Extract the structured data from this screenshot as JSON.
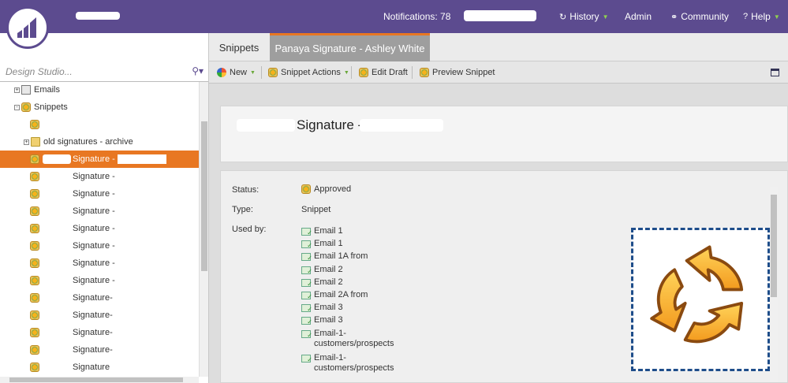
{
  "header": {
    "notifications_label": "Notifications: 78",
    "history_label": "History",
    "admin_label": "Admin",
    "community_label": "Community",
    "help_label": "Help"
  },
  "sidebar": {
    "search_placeholder": "Design Studio...",
    "tree": [
      {
        "label": "Emails",
        "indent": 1,
        "icon": "mail",
        "expander": "+",
        "selected": false
      },
      {
        "label": "Snippets",
        "indent": 1,
        "icon": "snippet",
        "expander": "-",
        "selected": false
      },
      {
        "label": "",
        "indent": 2,
        "icon": "snippet",
        "expander": "",
        "selected": false
      },
      {
        "label": "old signatures - archive",
        "indent": 2,
        "icon": "folder",
        "expander": "+",
        "selected": false
      },
      {
        "label": "Signature -",
        "indent": 2,
        "icon": "snippet",
        "expander": "",
        "selected": true
      },
      {
        "label": "Signature -",
        "indent": 2,
        "icon": "snippet",
        "expander": "",
        "selected": false
      },
      {
        "label": "Signature -",
        "indent": 2,
        "icon": "snippet",
        "expander": "",
        "selected": false
      },
      {
        "label": "Signature -",
        "indent": 2,
        "icon": "snippet",
        "expander": "",
        "selected": false
      },
      {
        "label": "Signature -",
        "indent": 2,
        "icon": "snippet",
        "expander": "",
        "selected": false
      },
      {
        "label": "Signature -",
        "indent": 2,
        "icon": "snippet",
        "expander": "",
        "selected": false
      },
      {
        "label": "Signature -",
        "indent": 2,
        "icon": "snippet",
        "expander": "",
        "selected": false
      },
      {
        "label": "Signature -",
        "indent": 2,
        "icon": "snippet",
        "expander": "",
        "selected": false
      },
      {
        "label": "Signature-",
        "indent": 2,
        "icon": "snippet",
        "expander": "",
        "selected": false
      },
      {
        "label": "Signature-",
        "indent": 2,
        "icon": "snippet",
        "expander": "",
        "selected": false
      },
      {
        "label": "Signature-",
        "indent": 2,
        "icon": "snippet",
        "expander": "",
        "selected": false
      },
      {
        "label": "Signature-",
        "indent": 2,
        "icon": "snippet",
        "expander": "",
        "selected": false
      },
      {
        "label": "Signature",
        "indent": 2,
        "icon": "snippet",
        "expander": "",
        "selected": false
      }
    ]
  },
  "tabs": [
    {
      "label": "Snippets",
      "active": false
    },
    {
      "label": "Panaya Signature - Ashley White",
      "active": true
    }
  ],
  "toolbar": {
    "new_label": "New",
    "snippet_actions_label": "Snippet Actions",
    "edit_draft_label": "Edit Draft",
    "preview_snippet_label": "Preview Snippet"
  },
  "asset": {
    "title": "Signature -",
    "status_label": "Status:",
    "status_value": "Approved",
    "type_label": "Type:",
    "type_value": "Snippet",
    "used_by_label": "Used by:",
    "used_by": [
      "Email 1",
      "Email 1",
      "Email 1A from",
      "Email 2",
      "Email 2",
      "Email 2A from",
      "Email 3",
      "Email 3",
      "Email-1-\ncustomers/prospects",
      "Email-1-\ncustomers/prospects"
    ]
  },
  "colors": {
    "header_bg": "#5c4b8f",
    "selected_row": "#e87722",
    "active_tab_accent": "#e87722",
    "preview_border": "#1e4d8a",
    "snippet_icon": "#f6b21b"
  }
}
